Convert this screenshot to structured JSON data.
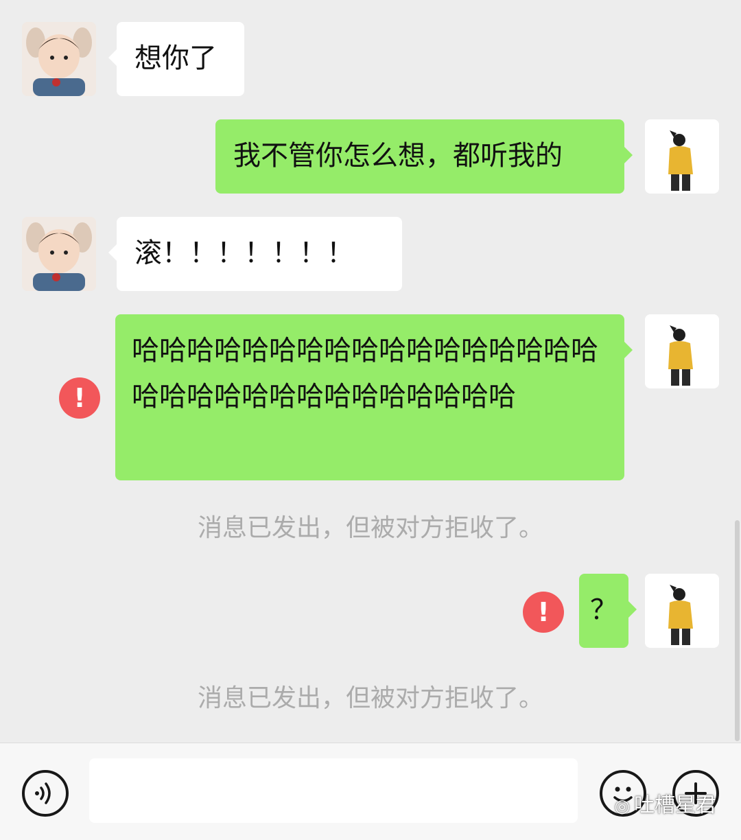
{
  "messages": [
    {
      "side": "left",
      "avatar": "baby-avatar",
      "text": "想你了"
    },
    {
      "side": "right",
      "avatar": "me-avatar",
      "text": "我不管你怎么想，都听我的"
    },
    {
      "side": "left",
      "avatar": "baby-avatar",
      "text": "滚！！！！！！！"
    },
    {
      "side": "right",
      "avatar": "me-avatar",
      "text": "哈哈哈哈哈哈哈哈哈哈哈哈哈哈哈哈哈哈哈哈哈哈哈哈哈哈哈哈哈哈哈",
      "failed": true,
      "notice": "消息已发出，但被对方拒收了。"
    },
    {
      "side": "right",
      "avatar": "me-avatar",
      "text": "？",
      "failed": true,
      "notice": "消息已发出，但被对方拒收了。"
    }
  ],
  "error_icon_glyph": "!",
  "input_bar": {
    "voice_icon": "voice-icon",
    "input_value": "",
    "emoji_icon": "emoji-icon",
    "plus_icon": "plus-icon"
  },
  "watermark": {
    "icon": "wechat-icon",
    "text": "吐槽星君"
  },
  "colors": {
    "background": "#ededed",
    "sent_bubble": "#95ec69",
    "received_bubble": "#ffffff",
    "error": "#f2575a",
    "notice_text": "#ababab"
  }
}
